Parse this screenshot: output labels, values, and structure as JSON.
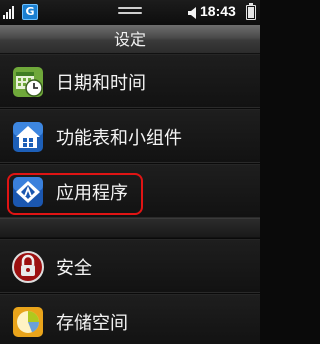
{
  "statusbar": {
    "network_badge": "G",
    "time": "18:43",
    "icons": [
      "signal-icon",
      "network-g-icon",
      "notification-handle-icon",
      "speaker-icon",
      "battery-icon"
    ]
  },
  "titlebar": {
    "title": "设定"
  },
  "settings": {
    "items": [
      {
        "label": "日期和时间",
        "icon": "calendar-clock-icon"
      },
      {
        "label": "功能表和小组件",
        "icon": "home-icon"
      },
      {
        "label": "应用程序",
        "icon": "apps-icon"
      },
      {
        "label": "安全",
        "icon": "lock-icon"
      },
      {
        "label": "存储空间",
        "icon": "storage-pie-icon"
      }
    ]
  },
  "annotation": {
    "color": "#e01414",
    "highlighted_item": "应用程序"
  }
}
